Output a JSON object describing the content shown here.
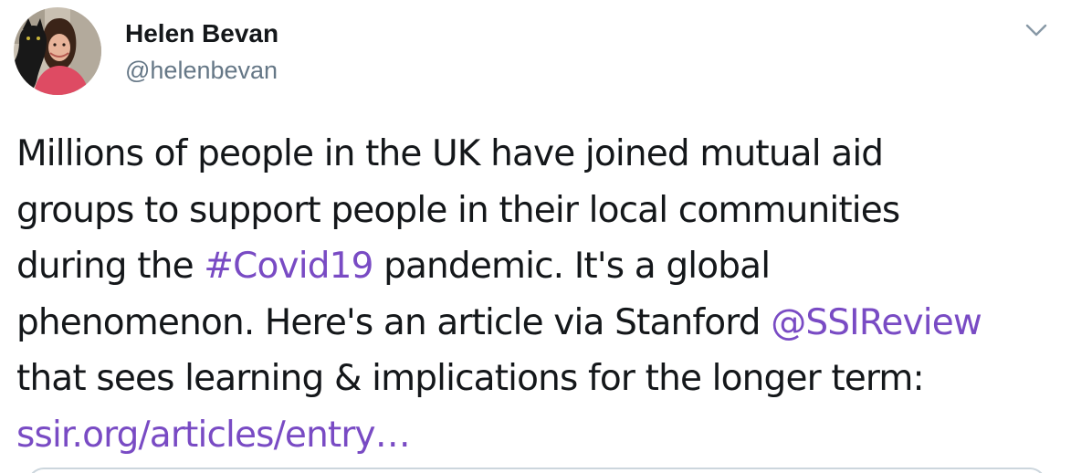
{
  "author": {
    "name": "Helen Bevan",
    "handle": "@helenbevan",
    "avatar_icon": "profile-photo-with-cat"
  },
  "menu": {
    "icon": "chevron-down-icon"
  },
  "tweet": {
    "lines": [
      [
        {
          "text": "Millions of people in the UK have joined mutual aid"
        }
      ],
      [
        {
          "text": "groups to support people in their local communities"
        }
      ],
      [
        {
          "text": "during the "
        },
        {
          "text": "#Covid19",
          "link": true
        },
        {
          "text": " pandemic. It's a global"
        }
      ],
      [
        {
          "text": "phenomenon. Here's an article via Stanford "
        },
        {
          "text": "@SSIReview",
          "link": true
        }
      ],
      [
        {
          "text": " that sees learning & implications for the longer term:"
        }
      ],
      [
        {
          "text": "ssir.org/articles/entry…",
          "link": true
        }
      ]
    ]
  },
  "colors": {
    "text": "#14171a",
    "secondary": "#657786",
    "link": "#794bc4",
    "border": "#ccd6dd"
  }
}
